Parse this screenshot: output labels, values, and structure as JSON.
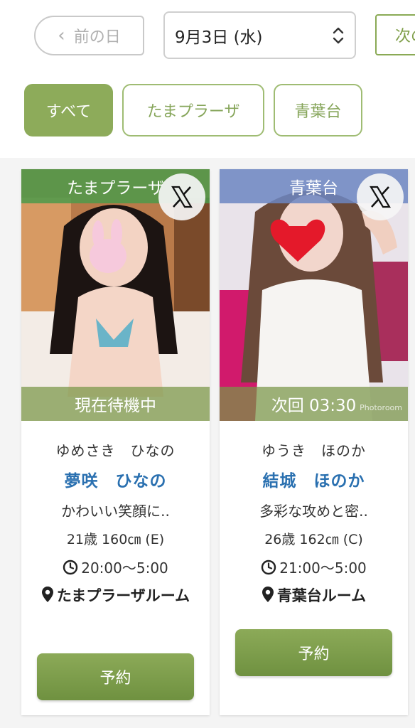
{
  "nav": {
    "prev_label": "前の日",
    "date_value": "9月3日 (水)",
    "next_label": "次の"
  },
  "filters": [
    {
      "label": "すべて",
      "active": true
    },
    {
      "label": "たまプラーザ",
      "active": false
    },
    {
      "label": "青葉台",
      "active": false
    }
  ],
  "cards": [
    {
      "area": "たまプラーザ",
      "area_color": "#4c9a4a",
      "status": "現在待機中",
      "kana": "ゆめさき　ひなの",
      "name": "夢咲　ひなの",
      "catchphrase": "かわいい笑顔に..",
      "spec": "21歳 160㎝ (E)",
      "time": "20:00〜5:00",
      "room": "たまプラーザルーム",
      "reserve_label": "予約"
    },
    {
      "area": "青葉台",
      "area_color": "#6c86c2",
      "status": "次回 03:30",
      "kana": "ゆうき　ほのか",
      "name": "結城　ほのか",
      "catchphrase": "多彩な攻めと密..",
      "spec": "26歳 162㎝ (C)",
      "time": "21:00〜5:00",
      "room": "青葉台ルーム",
      "reserve_label": "予約",
      "watermark": "Photoroom"
    }
  ],
  "colors": {
    "accent_green": "#8dab5a",
    "name_blue": "#2a70b0"
  },
  "icons": [
    "chevron-left-icon",
    "updown-chevron-icon",
    "x-logo-icon",
    "clock-icon",
    "map-pin-icon"
  ]
}
